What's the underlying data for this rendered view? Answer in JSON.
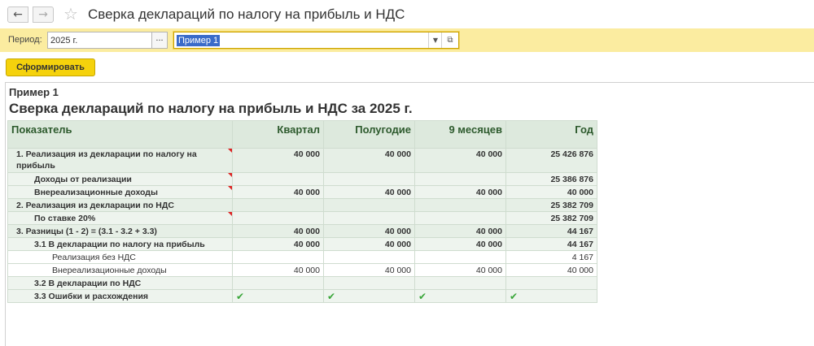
{
  "window": {
    "title": "Сверка деклараций по налогу на прибыль и НДС",
    "back_icon": "←",
    "forward_icon": "→",
    "favorite_icon": "☆"
  },
  "params": {
    "period_label": "Период:",
    "period_value": "2025 г.",
    "period_button": "...",
    "variant_value": "Пример 1"
  },
  "toolbar": {
    "generate_label": "Сформировать"
  },
  "report": {
    "variant": "Пример 1",
    "heading": "Сверка деклараций по налогу на прибыль и НДС за 2025 г.",
    "columns": [
      "Показатель",
      "Квартал",
      "Полугодие",
      "9 месяцев",
      "Год"
    ],
    "rows": [
      {
        "name": "1. Реализация из декларации по налогу на прибыль",
        "values": [
          "40 000",
          "40 000",
          "40 000",
          "25 426 876"
        ]
      },
      {
        "name": "Доходы от реализации",
        "values": [
          "",
          "",
          "",
          "25 386 876"
        ]
      },
      {
        "name": "Внереализационные доходы",
        "values": [
          "40 000",
          "40 000",
          "40 000",
          "40 000"
        ]
      },
      {
        "name": "2. Реализация из декларации по НДС",
        "values": [
          "",
          "",
          "",
          "25 382 709"
        ]
      },
      {
        "name": "По ставке 20%",
        "values": [
          "",
          "",
          "",
          "25 382 709"
        ]
      },
      {
        "name": "3. Разницы (1 - 2) = (3.1 - 3.2 + 3.3)",
        "values": [
          "40 000",
          "40 000",
          "40 000",
          "44 167"
        ]
      },
      {
        "name": "3.1 В декларации по налогу на прибыль",
        "values": [
          "40 000",
          "40 000",
          "40 000",
          "44 167"
        ]
      },
      {
        "name": "Реализация без НДС",
        "values": [
          "",
          "",
          "",
          "4 167"
        ]
      },
      {
        "name": "Внереализационные доходы",
        "values": [
          "40 000",
          "40 000",
          "40 000",
          "40 000"
        ]
      },
      {
        "name": "3.2 В декларации по НДС",
        "values": [
          "",
          "",
          "",
          ""
        ]
      },
      {
        "name": "3.3 Ошибки и расхождения",
        "values": [
          "",
          "",
          "",
          ""
        ]
      }
    ],
    "check_icon": "✔"
  },
  "colors": {
    "params_bg": "#fbeca0",
    "button_bg": "#f5d20c",
    "header_bg": "#dde9dd",
    "check": "#3aa63a"
  }
}
